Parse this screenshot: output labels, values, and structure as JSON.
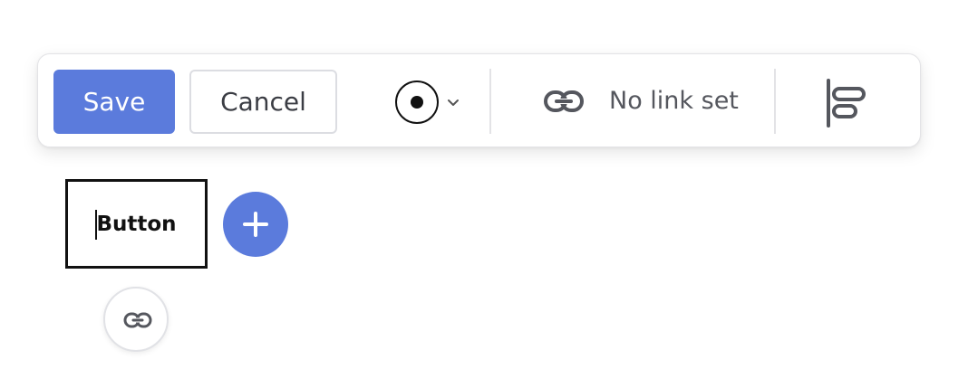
{
  "toolbar": {
    "save_label": "Save",
    "cancel_label": "Cancel",
    "radio_icon": "radio-selected-icon",
    "chevron_icon": "chevron-down-icon",
    "link_icon": "link-icon",
    "link_status": "No link set",
    "align_icon": "align-left-icon"
  },
  "canvas": {
    "button_label": "Button",
    "add_icon": "plus-icon",
    "link_icon": "link-icon"
  },
  "colors": {
    "accent": "#5b7bdc",
    "text_dark": "#111111",
    "text_muted": "#55575e",
    "border": "#dcdde2"
  }
}
